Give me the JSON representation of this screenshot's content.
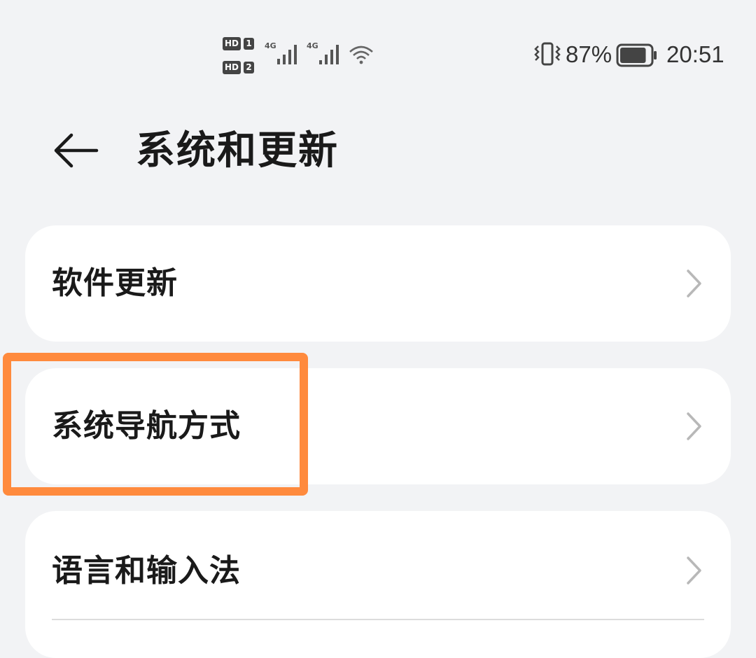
{
  "status_bar": {
    "hd_1": "HD",
    "sim_1": "1",
    "hd_2": "HD",
    "sim_2": "2",
    "network_1": "4G",
    "network_2": "4G",
    "battery_percent": "87%",
    "battery_level": 0.87,
    "time": "20:51",
    "icons": [
      "signal-icon",
      "wifi-icon",
      "vibrate-icon",
      "battery-icon"
    ]
  },
  "header": {
    "title": "系统和更新"
  },
  "items": [
    {
      "label": "软件更新"
    },
    {
      "label": "系统导航方式"
    },
    {
      "label": "语言和输入法"
    }
  ],
  "colors": {
    "background": "#f2f3f5",
    "card": "#ffffff",
    "highlight": "#ff8a3d",
    "chevron": "#b8b8b8"
  }
}
